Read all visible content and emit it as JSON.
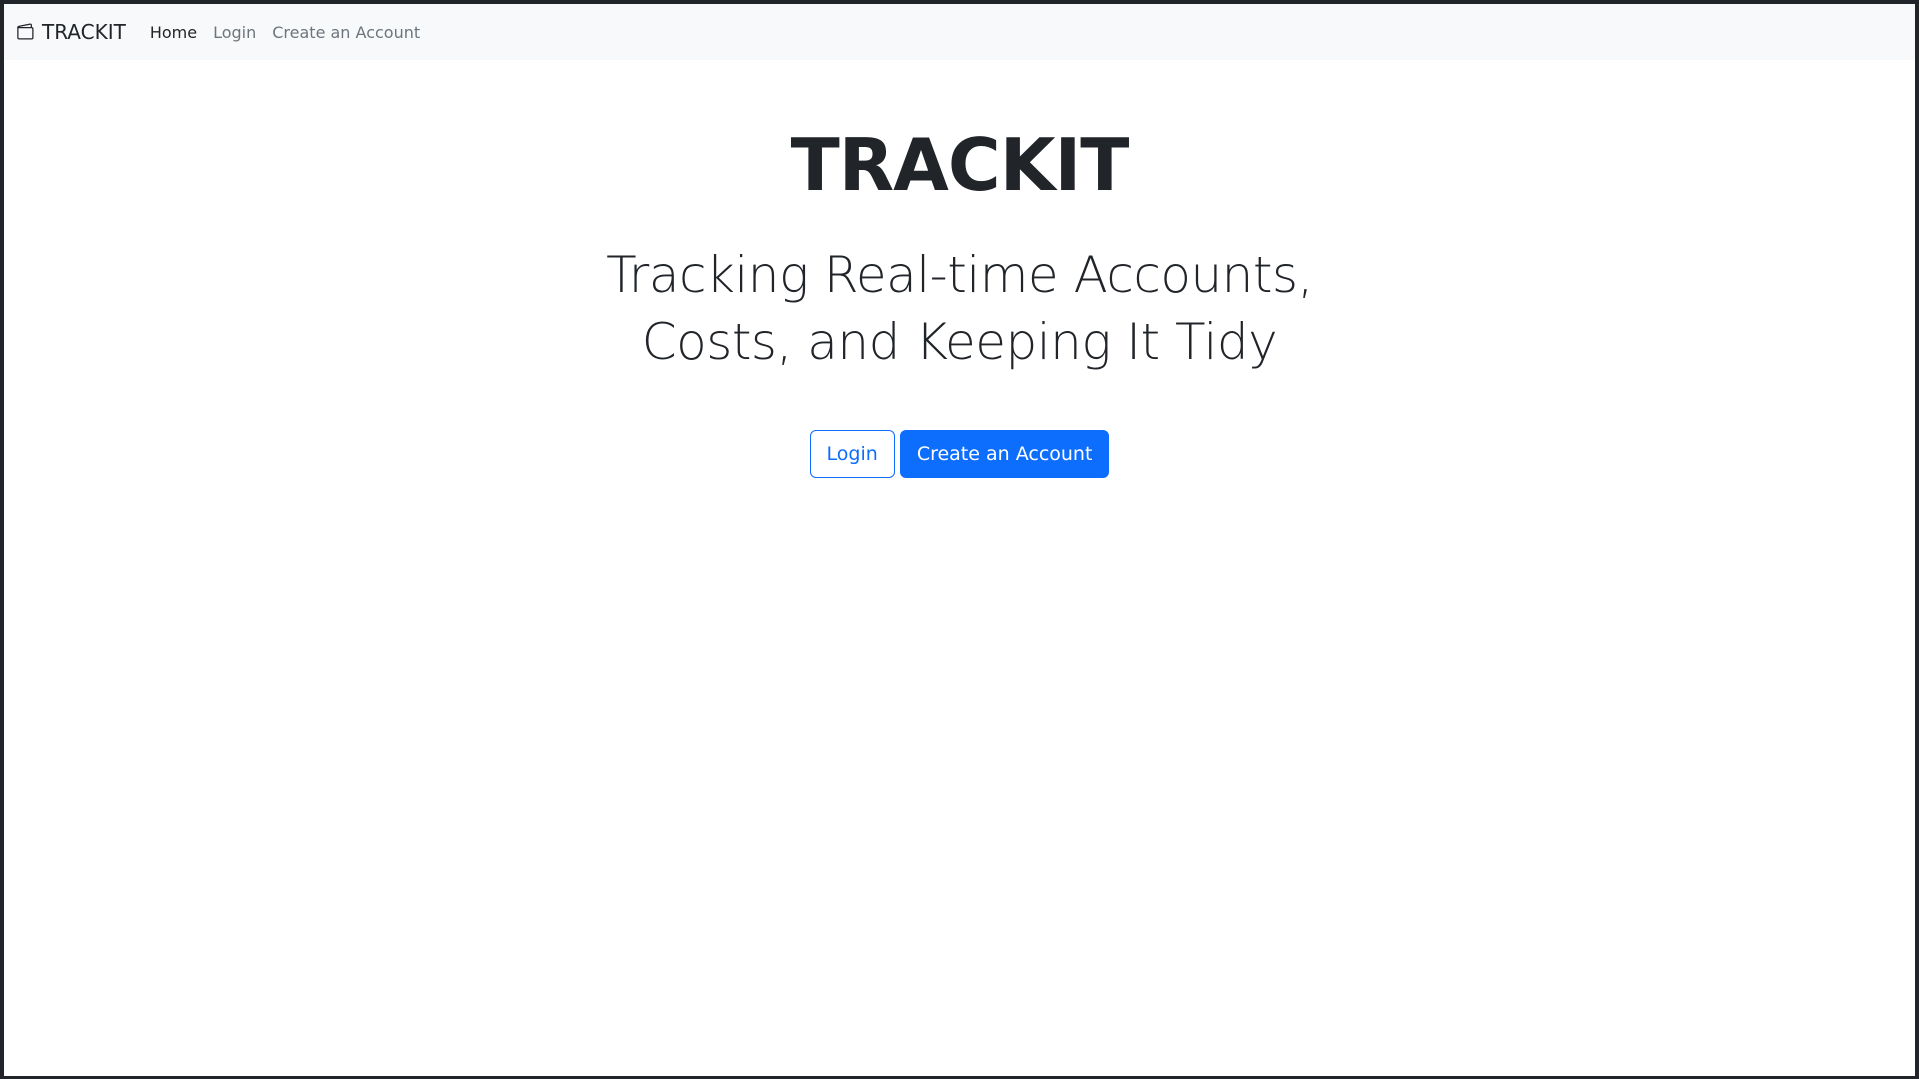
{
  "navbar": {
    "brand": "TRACKIT",
    "brand_icon": "wallet-icon",
    "links": [
      {
        "label": "Home",
        "active": true
      },
      {
        "label": "Login",
        "active": false
      },
      {
        "label": "Create an Account",
        "active": false
      }
    ]
  },
  "hero": {
    "title": "TRACKIT",
    "tagline_line1": "Tracking Real-time Accounts,",
    "tagline_line2": "Costs, and Keeping It Tidy"
  },
  "actions": {
    "login_label": "Login",
    "create_account_label": "Create an Account"
  },
  "colors": {
    "primary": "#0d6efd",
    "navbar_bg": "#f8f9fa",
    "text": "#212529",
    "muted": "#6c757d"
  }
}
